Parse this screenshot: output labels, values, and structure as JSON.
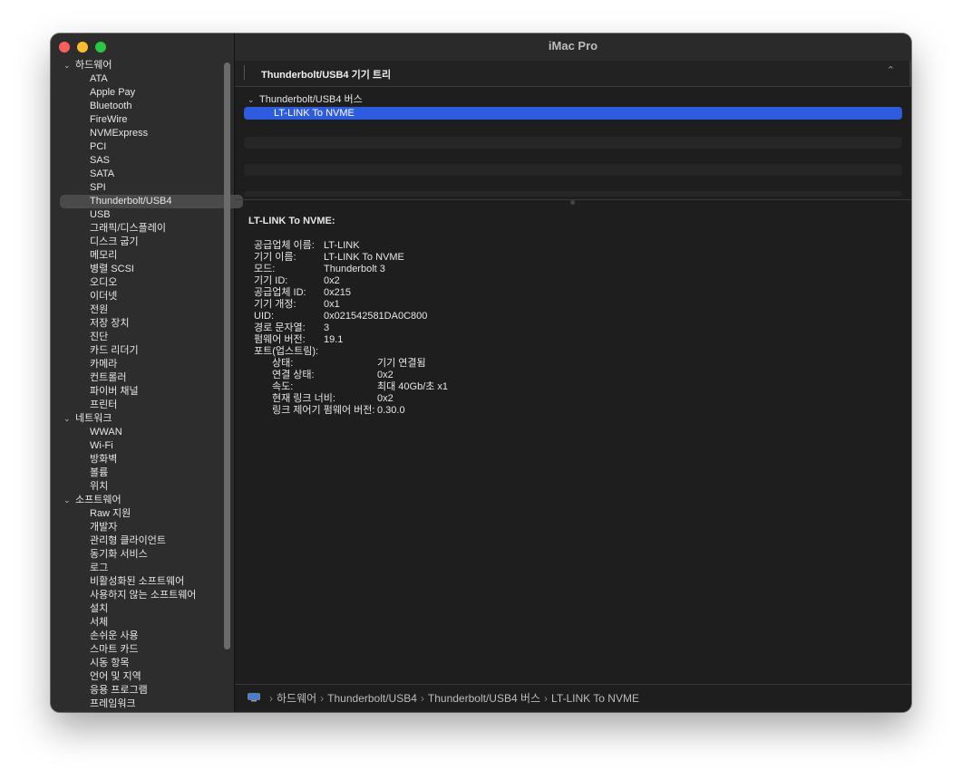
{
  "window": {
    "title": "iMac Pro"
  },
  "sidebar": {
    "sections": [
      {
        "label": "하드웨어",
        "items": [
          "ATA",
          "Apple Pay",
          "Bluetooth",
          "FireWire",
          "NVMExpress",
          "PCI",
          "SAS",
          "SATA",
          "SPI",
          "Thunderbolt/USB4",
          "USB",
          "그래픽/디스플레이",
          "디스크 굽기",
          "메모리",
          "병렬 SCSI",
          "오디오",
          "이더넷",
          "전원",
          "저장 장치",
          "진단",
          "카드 리더기",
          "카메라",
          "컨트롤러",
          "파이버 채널",
          "프린터"
        ]
      },
      {
        "label": "네트워크",
        "items": [
          "WWAN",
          "Wi-Fi",
          "방화벽",
          "볼륨",
          "위치"
        ]
      },
      {
        "label": "소프트웨어",
        "items": [
          "Raw 지원",
          "개발자",
          "관리형 클라이언트",
          "동기화 서비스",
          "로그",
          "비활성화된 소프트웨어",
          "사용하지 않는 소프트웨어",
          "설치",
          "서체",
          "손쉬운 사용",
          "스마트 카드",
          "시동 항목",
          "언어 및 지역",
          "응용 프로그램",
          "프레임워크"
        ]
      }
    ],
    "selected": "Thunderbolt/USB4"
  },
  "device_tree": {
    "header": "Thunderbolt/USB4 기기 트리",
    "bus": "Thunderbolt/USB4 버스",
    "device": "LT-LINK To NVME"
  },
  "details": {
    "title": "LT-LINK To NVME:",
    "props": [
      {
        "k": "공급업체 이름:",
        "v": "LT-LINK"
      },
      {
        "k": "기기 이름:",
        "v": "LT-LINK To NVME"
      },
      {
        "k": "모드:",
        "v": "Thunderbolt 3"
      },
      {
        "k": "기기 ID:",
        "v": "0x2"
      },
      {
        "k": "공급업체 ID:",
        "v": "0x215"
      },
      {
        "k": "기기 개정:",
        "v": "0x1"
      },
      {
        "k": "UID:",
        "v": "0x021542581DA0C800"
      },
      {
        "k": "경로 문자열:",
        "v": "3"
      },
      {
        "k": "펌웨어 버전:",
        "v": "19.1"
      },
      {
        "k": "포트(업스트림):",
        "v": ""
      }
    ],
    "port": [
      {
        "k": "상태:",
        "v": "기기 연결됨"
      },
      {
        "k": "연결 상태:",
        "v": "0x2"
      },
      {
        "k": "속도:",
        "v": "최대 40Gb/초 x1"
      },
      {
        "k": "현재 링크 너비:",
        "v": "0x2"
      },
      {
        "k": "링크 제어기 펌웨어 버전:",
        "v": "0.30.0"
      }
    ]
  },
  "pathbar": {
    "crumbs": [
      "하드웨어",
      "Thunderbolt/USB4",
      "Thunderbolt/USB4 버스",
      "LT-LINK To NVME"
    ]
  }
}
